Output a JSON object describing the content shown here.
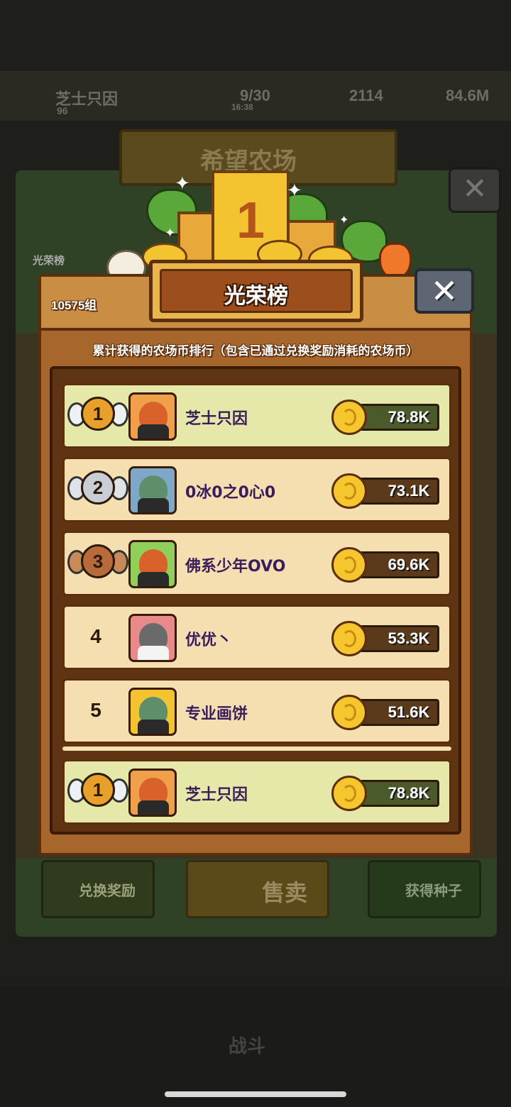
{
  "background": {
    "player_name": "芝士只因",
    "player_level": "96",
    "stat_1": "9/30",
    "stat_1_sub": "16:38",
    "stat_2": "2114",
    "stat_3": "84.6M",
    "farm_title": "希望农场",
    "side_label": "光荣榜",
    "btn_exchange": "兑换奖励",
    "btn_sell": "售卖",
    "btn_seed": "获得种子",
    "battle_label": "战斗"
  },
  "trophy_number": "1",
  "panel": {
    "group_count": "10575组",
    "title": "光荣榜",
    "close_symbol": "✕",
    "subtitle": "累计获得的农场币排行（包含已通过兑换奖励消耗的农场币）"
  },
  "ranking": [
    {
      "rank": "1",
      "name": "芝士只因",
      "score": "78.8K"
    },
    {
      "rank": "2",
      "name": "0冰0之0心0",
      "score": "73.1K"
    },
    {
      "rank": "3",
      "name": "佛系少年OVO",
      "score": "69.6K"
    },
    {
      "rank": "4",
      "name": "优优丶",
      "score": "53.3K"
    },
    {
      "rank": "5",
      "name": "专业画饼",
      "score": "51.6K"
    }
  ],
  "my_rank": {
    "rank": "1",
    "name": "芝士只因",
    "score": "78.8K"
  },
  "colors": {
    "gold_medal": "#e8a02a",
    "silver_medal": "#c9ced6",
    "bronze_medal": "#b86a3a",
    "panel_brown": "#a7662b",
    "first_row": "#e5e8a8",
    "row": "#f5deb0"
  }
}
